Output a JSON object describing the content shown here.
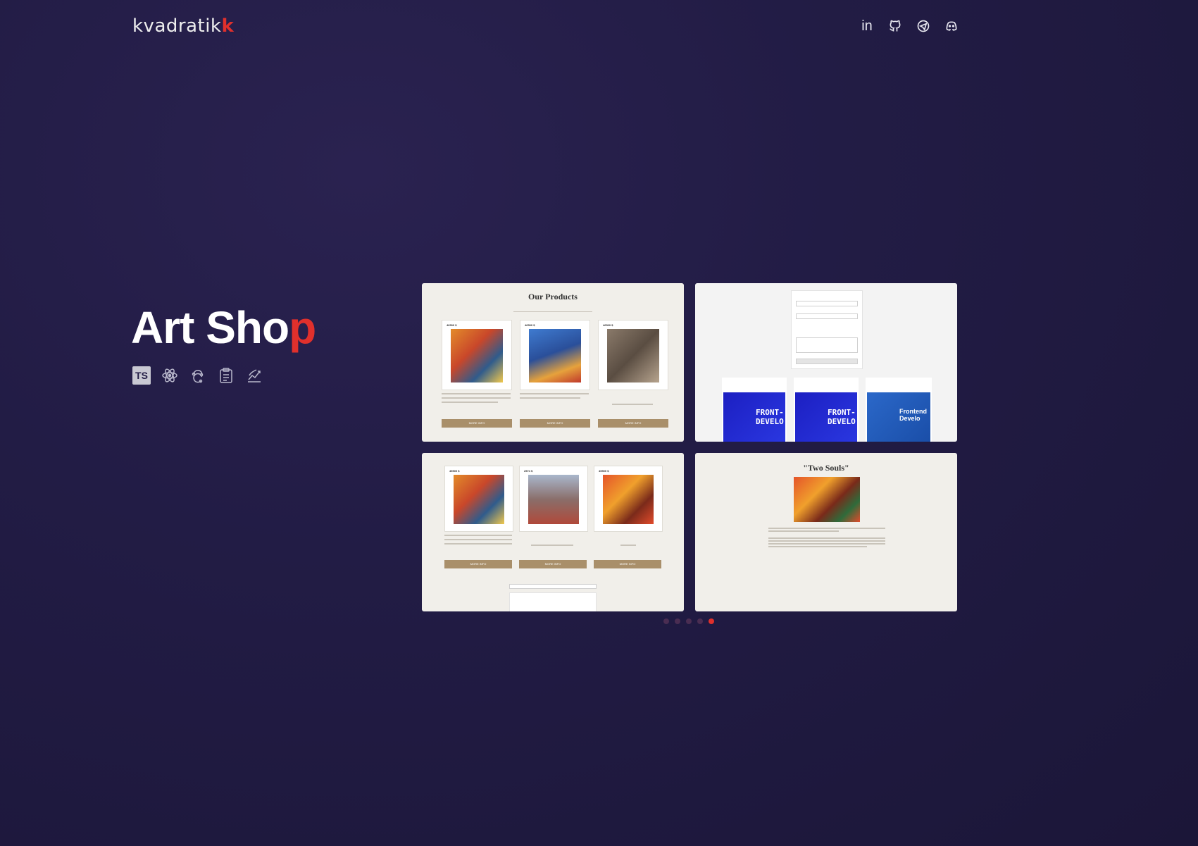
{
  "header": {
    "logo_main": "kvadratik",
    "logo_accent": "k",
    "social": [
      {
        "name": "linkedin-icon",
        "glyph": "in"
      },
      {
        "name": "github-icon",
        "glyph": "github"
      },
      {
        "name": "telegram-icon",
        "glyph": "telegram"
      },
      {
        "name": "discord-icon",
        "glyph": "discord"
      }
    ]
  },
  "project": {
    "title_main": "Art Sho",
    "title_accent": "p",
    "stack_icons": [
      "typescript-icon",
      "react-icon",
      "redux-icon",
      "clipboard-icon",
      "chart-icon"
    ],
    "ts_label": "TS"
  },
  "screens": {
    "s1_title": "Our Products",
    "s1_buttons": [
      "MORE INFO",
      "MORE INFO",
      "MORE INFO"
    ],
    "s1_prices": [
      "46500 $",
      "46500 $",
      "46500 $"
    ],
    "s3_buttons": [
      "MORE INFO",
      "MORE INFO",
      "MORE INFO"
    ],
    "s3_prices": [
      "45500 $",
      "2574 $",
      "45500 $"
    ],
    "s2_course_labels": [
      "FRONT-\nDEVELO",
      "FRONT-\nDEVELO",
      "Frontend\nDevelo"
    ],
    "s4_title": "\"Two Souls\""
  },
  "carousel": {
    "count": 5,
    "active_index": 4
  },
  "colors": {
    "accent": "#e0302c",
    "background": "#221c45",
    "button": "#a98f6a"
  }
}
